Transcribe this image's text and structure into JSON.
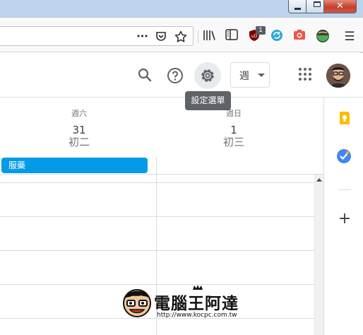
{
  "window": {
    "minimize_glyph": "",
    "close_glyph": "✕"
  },
  "browser": {
    "page_actions_glyph": "•••",
    "icons": [
      "page-actions-icon",
      "pocket-icon",
      "bookmark-star-icon",
      "library-icon",
      "sidebar-icon",
      "ublock-icon",
      "sync-extension-icon",
      "screenshot-icon",
      "green-extension-icon",
      "hamburger-menu-icon"
    ],
    "ublock_badge": "1",
    "menu_glyph": "☰"
  },
  "header": {
    "view_label": "週",
    "tooltip": "設定選單"
  },
  "days": [
    {
      "name": "週六",
      "number": "31",
      "lunar": "初二"
    },
    {
      "name": "週日",
      "number": "1",
      "lunar": "初三"
    }
  ],
  "events": [
    {
      "title": "服藥",
      "color": "#039be5"
    }
  ],
  "side_panel": {
    "icons": [
      "keep-icon",
      "tasks-icon",
      "add-icon"
    ],
    "add_glyph": "+"
  },
  "watermark": {
    "title": "電腦王阿達",
    "url": "http://www.kocpc.com.tw"
  },
  "colors": {
    "event_blue": "#039be5",
    "keep_yellow": "#fbbc04",
    "tasks_blue": "#4285f4",
    "tooltip_bg": "#5f6368"
  }
}
